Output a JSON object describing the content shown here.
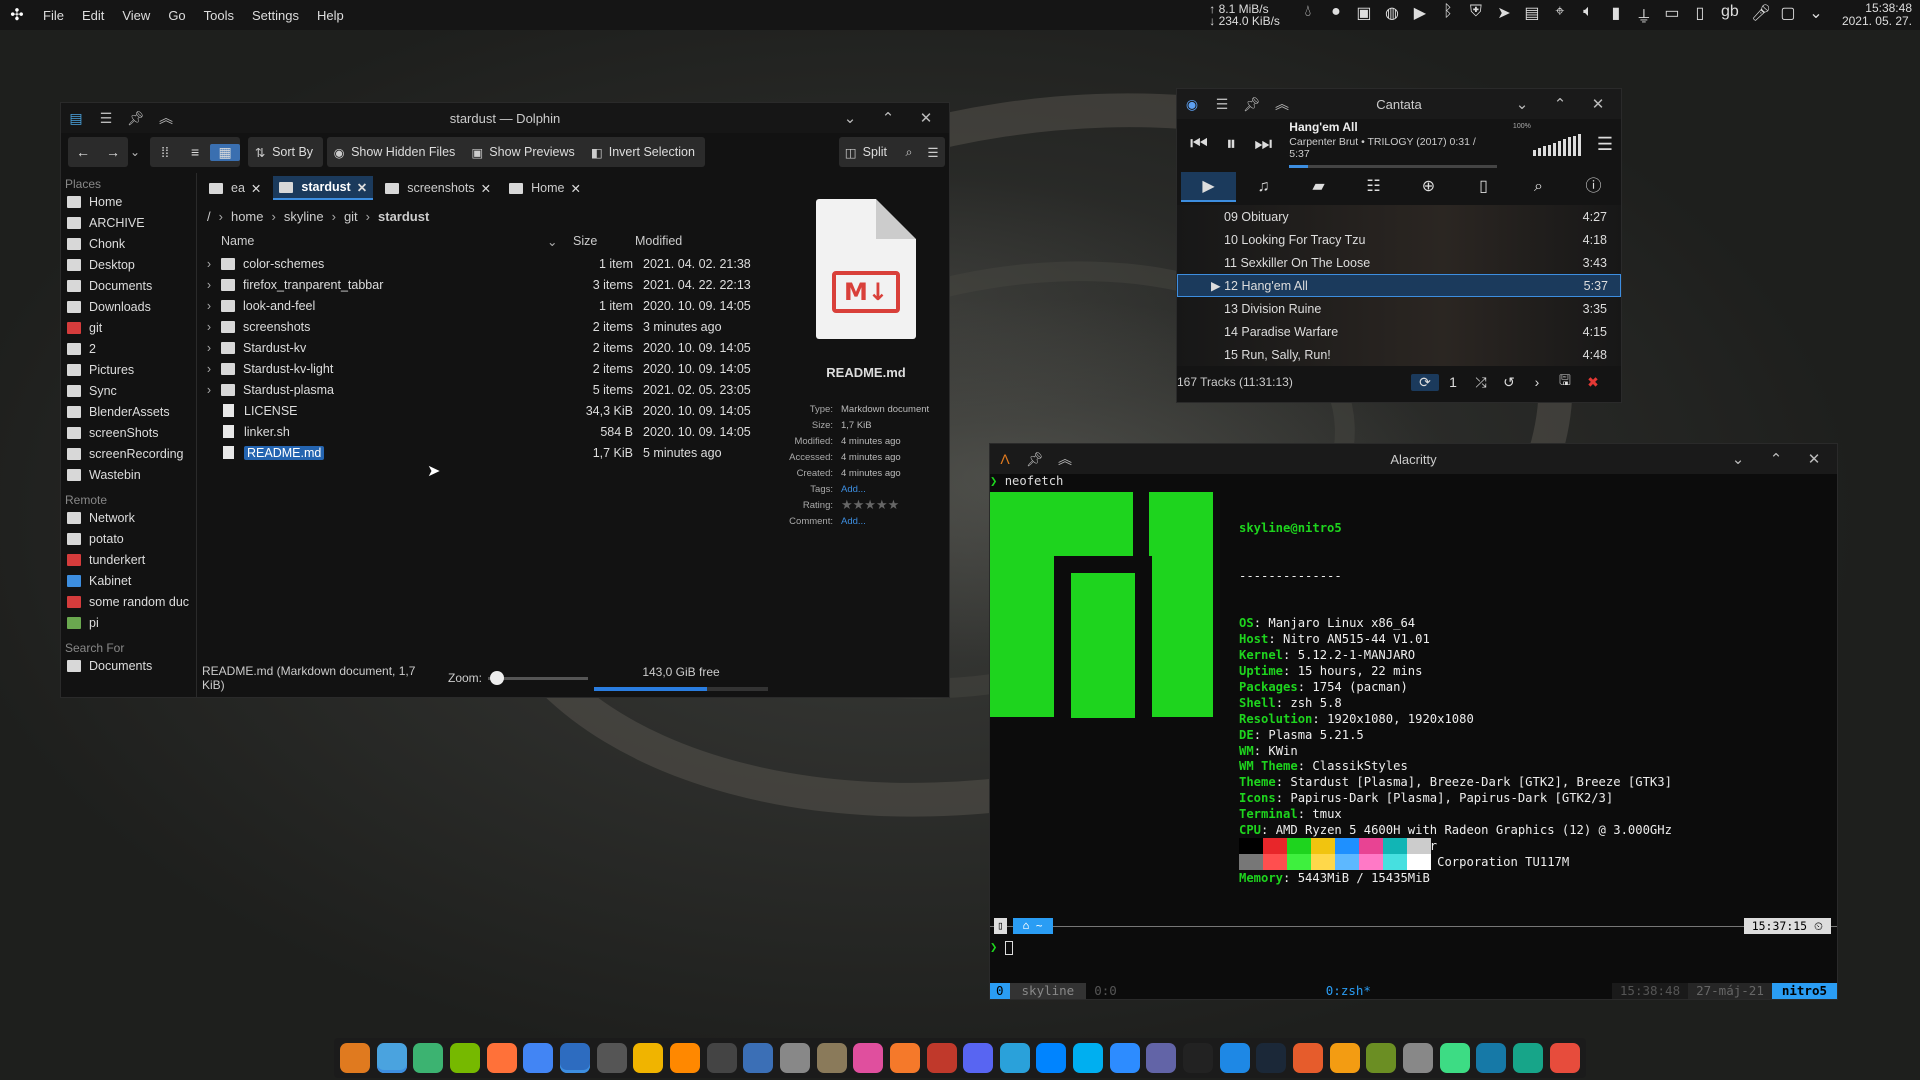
{
  "panel": {
    "menu": [
      "File",
      "Edit",
      "View",
      "Go",
      "Tools",
      "Settings",
      "Help"
    ],
    "net_up": "8.1 MiB/s",
    "net_down": "234.0 KiB/s",
    "kbd": "gb",
    "time": "15:38:48",
    "date": "2021. 05. 27.",
    "tray_icons": [
      "water-drop-icon",
      "circle-icon",
      "notification-icon",
      "discord-icon",
      "play-icon",
      "bluetooth-icon",
      "shield-icon",
      "telegram-icon",
      "clipboard-icon",
      "location-icon",
      "speaker-icon",
      "battery-icon",
      "usb-icon",
      "display-icon",
      "phone-icon",
      "microphone-icon",
      "monitor-icon",
      "chevron-down-icon"
    ]
  },
  "dolphin": {
    "title": "stardust — Dolphin",
    "toolbar": {
      "sort": "Sort By",
      "hidden": "Show Hidden Files",
      "previews": "Show Previews",
      "invert": "Invert Selection",
      "split": "Split"
    },
    "places_title": "Places",
    "places": [
      {
        "label": "Home",
        "c": ""
      },
      {
        "label": "ARCHIVE",
        "c": ""
      },
      {
        "label": "Chonk",
        "c": ""
      },
      {
        "label": "Desktop",
        "c": ""
      },
      {
        "label": "Documents",
        "c": ""
      },
      {
        "label": "Downloads",
        "c": ""
      },
      {
        "label": "git",
        "c": "red"
      },
      {
        "label": "2",
        "c": ""
      },
      {
        "label": "Pictures",
        "c": ""
      },
      {
        "label": "Sync",
        "c": ""
      },
      {
        "label": "BlenderAssets",
        "c": ""
      },
      {
        "label": "screenShots",
        "c": ""
      },
      {
        "label": "screenRecording",
        "c": ""
      },
      {
        "label": "Wastebin",
        "c": ""
      }
    ],
    "remote_title": "Remote",
    "remote": [
      {
        "label": "Network",
        "c": ""
      },
      {
        "label": "potato",
        "c": ""
      },
      {
        "label": "tunderkert",
        "c": "red"
      },
      {
        "label": "Kabinet",
        "c": "blue"
      },
      {
        "label": "some random duc",
        "c": "red"
      },
      {
        "label": "pi",
        "c": "green"
      }
    ],
    "search_title": "Search For",
    "search": [
      {
        "label": "Documents",
        "c": ""
      }
    ],
    "tabs": [
      "ea",
      "stardust",
      "screenshots",
      "Home"
    ],
    "crumbs": [
      "/",
      "home",
      "skyline",
      "git",
      "stardust"
    ],
    "cols": {
      "name": "Name",
      "size": "Size",
      "modified": "Modified"
    },
    "files": [
      {
        "name": "color-schemes",
        "size": "1 item",
        "mod": "2021. 04. 02. 21:38",
        "dir": true
      },
      {
        "name": "firefox_tranparent_tabbar",
        "size": "3 items",
        "mod": "2021. 04. 22. 22:13",
        "dir": true
      },
      {
        "name": "look-and-feel",
        "size": "1 item",
        "mod": "2020. 10. 09. 14:05",
        "dir": true
      },
      {
        "name": "screenshots",
        "size": "2 items",
        "mod": "3 minutes ago",
        "dir": true
      },
      {
        "name": "Stardust-kv",
        "size": "2 items",
        "mod": "2020. 10. 09. 14:05",
        "dir": true
      },
      {
        "name": "Stardust-kv-light",
        "size": "2 items",
        "mod": "2020. 10. 09. 14:05",
        "dir": true
      },
      {
        "name": "Stardust-plasma",
        "size": "5 items",
        "mod": "2021. 02. 05. 23:05",
        "dir": true
      },
      {
        "name": "LICENSE",
        "size": "34,3 KiB",
        "mod": "2020. 10. 09. 14:05",
        "dir": false
      },
      {
        "name": "linker.sh",
        "size": "584 B",
        "mod": "2020. 10. 09. 14:05",
        "dir": false
      },
      {
        "name": "README.md",
        "size": "1,7 KiB",
        "mod": "5 minutes ago",
        "dir": false
      }
    ],
    "info": {
      "name": "README.md",
      "icon_text": "M↓",
      "type_k": "Type:",
      "type_v": "Markdown document",
      "size_k": "Size:",
      "size_v": "1,7 KiB",
      "modified_k": "Modified:",
      "modified_v": "4 minutes ago",
      "accessed_k": "Accessed:",
      "accessed_v": "4 minutes ago",
      "created_k": "Created:",
      "created_v": "4 minutes ago",
      "tags_k": "Tags:",
      "tags_v": "Add...",
      "rating_k": "Rating:",
      "rating_v": "★★★★★",
      "comment_k": "Comment:",
      "comment_v": "Add..."
    },
    "status": "README.md (Markdown document, 1,7 KiB)",
    "zoom": "Zoom:",
    "free": "143,0 GiB free",
    "free_fraction": 0.65
  },
  "cantata": {
    "title": "Cantata",
    "song": "Hang'em All",
    "sub": "Carpenter Brut • TRILOGY (2017)  0:31 / 5:37",
    "volume": "100%",
    "progress": 0.09,
    "tracks": [
      {
        "n": "09 Obituary",
        "d": "4:27"
      },
      {
        "n": "10 Looking For Tracy Tzu",
        "d": "4:18"
      },
      {
        "n": "11 Sexkiller On The Loose",
        "d": "3:43"
      },
      {
        "n": "12 Hang'em All",
        "d": "5:37"
      },
      {
        "n": "13 Division Ruine",
        "d": "3:35"
      },
      {
        "n": "14 Paradise Warfare",
        "d": "4:15"
      },
      {
        "n": "15 Run, Sally, Run!",
        "d": "4:48"
      }
    ],
    "footer": "167 Tracks (11:31:13)",
    "single": "1"
  },
  "alacritty": {
    "title": "Alacritty",
    "cmd": "neofetch",
    "user": "skyline@nitro5",
    "dashes": "--------------",
    "info": [
      {
        "k": "OS",
        "v": "Manjaro Linux x86_64"
      },
      {
        "k": "Host",
        "v": "Nitro AN515-44 V1.01"
      },
      {
        "k": "Kernel",
        "v": "5.12.2-1-MANJARO"
      },
      {
        "k": "Uptime",
        "v": "15 hours, 22 mins"
      },
      {
        "k": "Packages",
        "v": "1754 (pacman)"
      },
      {
        "k": "Shell",
        "v": "zsh 5.8"
      },
      {
        "k": "Resolution",
        "v": "1920x1080, 1920x1080"
      },
      {
        "k": "DE",
        "v": "Plasma 5.21.5"
      },
      {
        "k": "WM",
        "v": "KWin"
      },
      {
        "k": "WM Theme",
        "v": "ClassikStyles"
      },
      {
        "k": "Theme",
        "v": "Stardust [Plasma], Breeze-Dark [GTK2], Breeze [GTK3]"
      },
      {
        "k": "Icons",
        "v": "Papirus-Dark [Plasma], Papirus-Dark [GTK2/3]"
      },
      {
        "k": "Terminal",
        "v": "tmux"
      },
      {
        "k": "CPU",
        "v": "AMD Ryzen 5 4600H with Radeon Graphics (12) @ 3.000GHz"
      },
      {
        "k": "GPU",
        "v": "AMD ATI 05:00.0 Renoir"
      },
      {
        "k": "GPU",
        "v": "NVIDIA 01:00.0 NVIDIA Corporation TU117M"
      },
      {
        "k": "Memory",
        "v": "5443MiB / 15435MiB"
      }
    ],
    "colors_top": [
      "#000000",
      "#e8262a",
      "#1ed41e",
      "#f1c40f",
      "#1e90ff",
      "#e84393",
      "#11b5b5",
      "#cccccc"
    ],
    "colors_bot": [
      "#777777",
      "#ff4f4f",
      "#3ef03e",
      "#ffd84a",
      "#5db8ff",
      "#ff79c6",
      "#46e0e0",
      "#ffffff"
    ],
    "prompt_time": "15:37:15",
    "prompt_home": "~",
    "tmux": {
      "win": "0",
      "session": "skyline",
      "pane": "0:0",
      "active": "0:zsh*",
      "time": "15:38:48",
      "date": "27-máj-21",
      "host": "nitro5"
    }
  },
  "taskbar": [
    {
      "name": "alacritty-icon",
      "c": "#e07a1f"
    },
    {
      "name": "dolphin-icon",
      "c": "#4aa3df"
    },
    {
      "name": "files-icon",
      "c": "#3cb371"
    },
    {
      "name": "nvidia-icon",
      "c": "#76b900"
    },
    {
      "name": "firefox-icon",
      "c": "#ff7139"
    },
    {
      "name": "chrome-icon",
      "c": "#4285f4"
    },
    {
      "name": "cantata-icon",
      "c": "#2d6cc0"
    },
    {
      "name": "monitor-icon",
      "c": "#555555"
    },
    {
      "name": "music-icon",
      "c": "#f0b400"
    },
    {
      "name": "vlc-icon",
      "c": "#ff8800"
    },
    {
      "name": "obs-icon",
      "c": "#444444"
    },
    {
      "name": "kdenlive-icon",
      "c": "#3b6fb6"
    },
    {
      "name": "inkscape-icon",
      "c": "#888888"
    },
    {
      "name": "gimp-icon",
      "c": "#8a7a5a"
    },
    {
      "name": "krita-icon",
      "c": "#e04f9e"
    },
    {
      "name": "blender-icon",
      "c": "#f5792a"
    },
    {
      "name": "archive-icon",
      "c": "#c0392b"
    },
    {
      "name": "discord-icon",
      "c": "#5865f2"
    },
    {
      "name": "telegram-icon",
      "c": "#2aa1da"
    },
    {
      "name": "messenger-icon",
      "c": "#0084ff"
    },
    {
      "name": "skype-icon",
      "c": "#00aff0"
    },
    {
      "name": "zoom-icon",
      "c": "#2d8cff"
    },
    {
      "name": "teams-icon",
      "c": "#6264a7"
    },
    {
      "name": "intellij-icon",
      "c": "#222222"
    },
    {
      "name": "writer-icon",
      "c": "#1e88e5"
    },
    {
      "name": "steam-icon",
      "c": "#1b2838"
    },
    {
      "name": "burp-icon",
      "c": "#e65c2c"
    },
    {
      "name": "settings-icon",
      "c": "#f39c12"
    },
    {
      "name": "minecraft-icon",
      "c": "#6b8e23"
    },
    {
      "name": "usb-icon",
      "c": "#888888"
    },
    {
      "name": "android-icon",
      "c": "#3ddc84"
    },
    {
      "name": "wireshark-icon",
      "c": "#1679a7"
    },
    {
      "name": "gitkraken-icon",
      "c": "#17a589"
    },
    {
      "name": "game-icon",
      "c": "#e74c3c"
    }
  ]
}
